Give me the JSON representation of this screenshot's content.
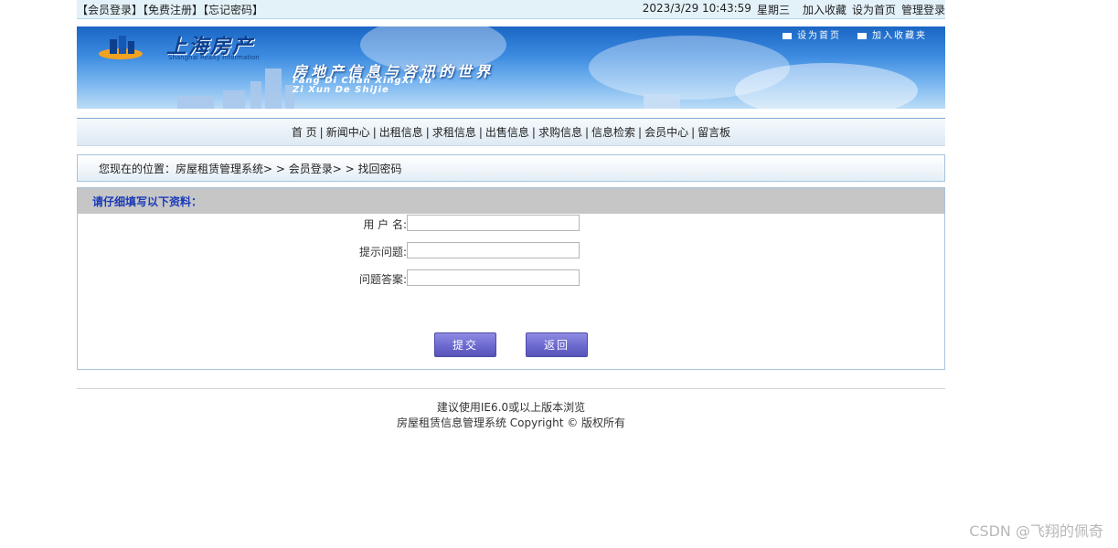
{
  "topbar": {
    "member_login": "【会员登录】",
    "free_register": "【免费注册】",
    "forgot_password": "【忘记密码】",
    "datetime": "2023/3/29 10:43:59",
    "weekday": "星期三",
    "add_favorite": "加入收藏",
    "set_homepage": "设为首页",
    "admin_login": "管理登录"
  },
  "banner": {
    "logo_text": "上海房产",
    "logo_sub": "Shanghai Realty Information",
    "slogan": "房地产信息与咨讯的世界",
    "pinyin_line1": "Fang Di Chan XingXi Yu",
    "pinyin_line2": "Zi Xun De ShiJie",
    "link_set_home": "设为首页",
    "link_add_fav": "加入收藏夹"
  },
  "nav": {
    "items": [
      "首 页",
      "新闻中心",
      "出租信息",
      "求租信息",
      "出售信息",
      "求购信息",
      "信息检索",
      "会员中心",
      "留言板"
    ],
    "separator": "|"
  },
  "breadcrumb": {
    "text": "您现在的位置：房屋租赁管理系统> > 会员登录> > 找回密码"
  },
  "form": {
    "header": "请仔细填写以下资料：",
    "username_label": "用 户 名:",
    "username_value": "",
    "question_label": "提示问题:",
    "question_value": "",
    "answer_label": "问题答案:",
    "answer_value": "",
    "submit_label": "提交",
    "back_label": "返回"
  },
  "footer": {
    "line1": "建议使用IE6.0或以上版本浏览",
    "line2": "房屋租赁信息管理系统 Copyright © 版权所有"
  },
  "watermark": "CSDN @飞翔的佩奇"
}
